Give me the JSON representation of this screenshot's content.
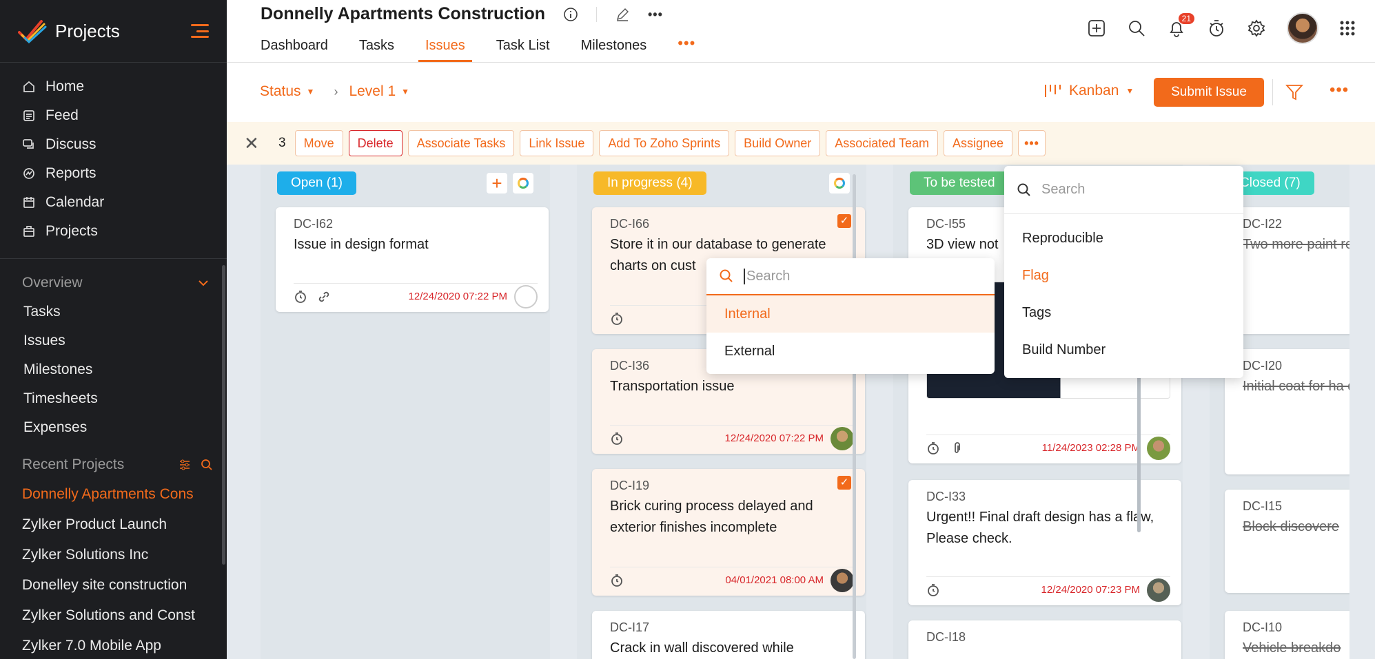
{
  "sidebar": {
    "title": "Projects",
    "nav": [
      {
        "label": "Home",
        "icon": "home-icon"
      },
      {
        "label": "Feed",
        "icon": "feed-icon"
      },
      {
        "label": "Discuss",
        "icon": "discuss-icon"
      },
      {
        "label": "Reports",
        "icon": "reports-icon"
      },
      {
        "label": "Calendar",
        "icon": "calendar-icon"
      },
      {
        "label": "Projects",
        "icon": "projects-icon"
      }
    ],
    "overview_label": "Overview",
    "overview_items": [
      "Tasks",
      "Issues",
      "Milestones",
      "Timesheets",
      "Expenses"
    ],
    "recent_label": "Recent Projects",
    "recent_projects": [
      "Donnelly Apartments Cons",
      "Zylker Product Launch",
      "Zylker Solutions Inc",
      "Donelley site construction",
      "Zylker Solutions and Const",
      "Zylker 7.0 Mobile App"
    ]
  },
  "header": {
    "project_title": "Donnelly Apartments Construction",
    "tabs": [
      "Dashboard",
      "Tasks",
      "Issues",
      "Task List",
      "Milestones"
    ],
    "active_tab": "Issues",
    "more": "•••",
    "notification_count": "21"
  },
  "toolbar": {
    "status_label": "Status",
    "level_label": "Level 1",
    "view_label": "Kanban",
    "submit_label": "Submit Issue",
    "more": "•••"
  },
  "bulk": {
    "selected_count": "3",
    "actions": [
      "Move",
      "Delete",
      "Associate Tasks",
      "Link Issue",
      "Add To Zoho Sprints",
      "Build Owner",
      "Associated Team",
      "Assignee"
    ],
    "more": "•••"
  },
  "columns": [
    {
      "label": "Open (1)",
      "color": "#1eaeea"
    },
    {
      "label": "In progress (4)",
      "color": "#f7b928"
    },
    {
      "label": "To be tested",
      "color": "#5dc378"
    },
    {
      "label": "Closed (7)",
      "color": "#3fd6c4"
    }
  ],
  "cards": {
    "open": [
      {
        "id": "DC-I62",
        "title": "Issue in design format",
        "date": "12/24/2020 07:22 PM"
      }
    ],
    "in_progress": [
      {
        "id": "DC-I66",
        "title": "Store it in our database to generate charts on cust",
        "date": ""
      },
      {
        "id": "DC-I36",
        "title": "Transportation issue",
        "date": "12/24/2020 07:22 PM"
      },
      {
        "id": "DC-I19",
        "title": "Brick curing process delayed and exterior finishes incomplete",
        "date": "04/01/2021 08:00 AM"
      },
      {
        "id": "DC-I17",
        "title": "Crack in wall discovered while"
      }
    ],
    "to_be_tested": [
      {
        "id": "DC-I55",
        "title": "3D view not",
        "date": "11/24/2023 02:28 PM"
      },
      {
        "id": "DC-I33",
        "title": "Urgent!! Final draft design has a flaw, Please check.",
        "date": "12/24/2020 07:23 PM"
      },
      {
        "id": "DC-I18",
        "title": ""
      }
    ],
    "closed": [
      {
        "id": "DC-I22",
        "title": "Two more paint reach site. Com"
      },
      {
        "id": "DC-I20",
        "title": "Initial coat for ha due to insufficie"
      },
      {
        "id": "DC-I15",
        "title": "Block discovere"
      },
      {
        "id": "DC-I10",
        "title": "Vehicle breakdo"
      }
    ]
  },
  "team_dropdown": {
    "placeholder": "Search",
    "options": [
      "Internal",
      "External"
    ]
  },
  "more_dropdown": {
    "placeholder": "Search",
    "options": [
      "Reproducible",
      "Flag",
      "Tags",
      "Build Number"
    ]
  },
  "colors": {
    "accent": "#f26a1b",
    "danger": "#d8262a",
    "sidebar_bg": "#1d1e21"
  }
}
